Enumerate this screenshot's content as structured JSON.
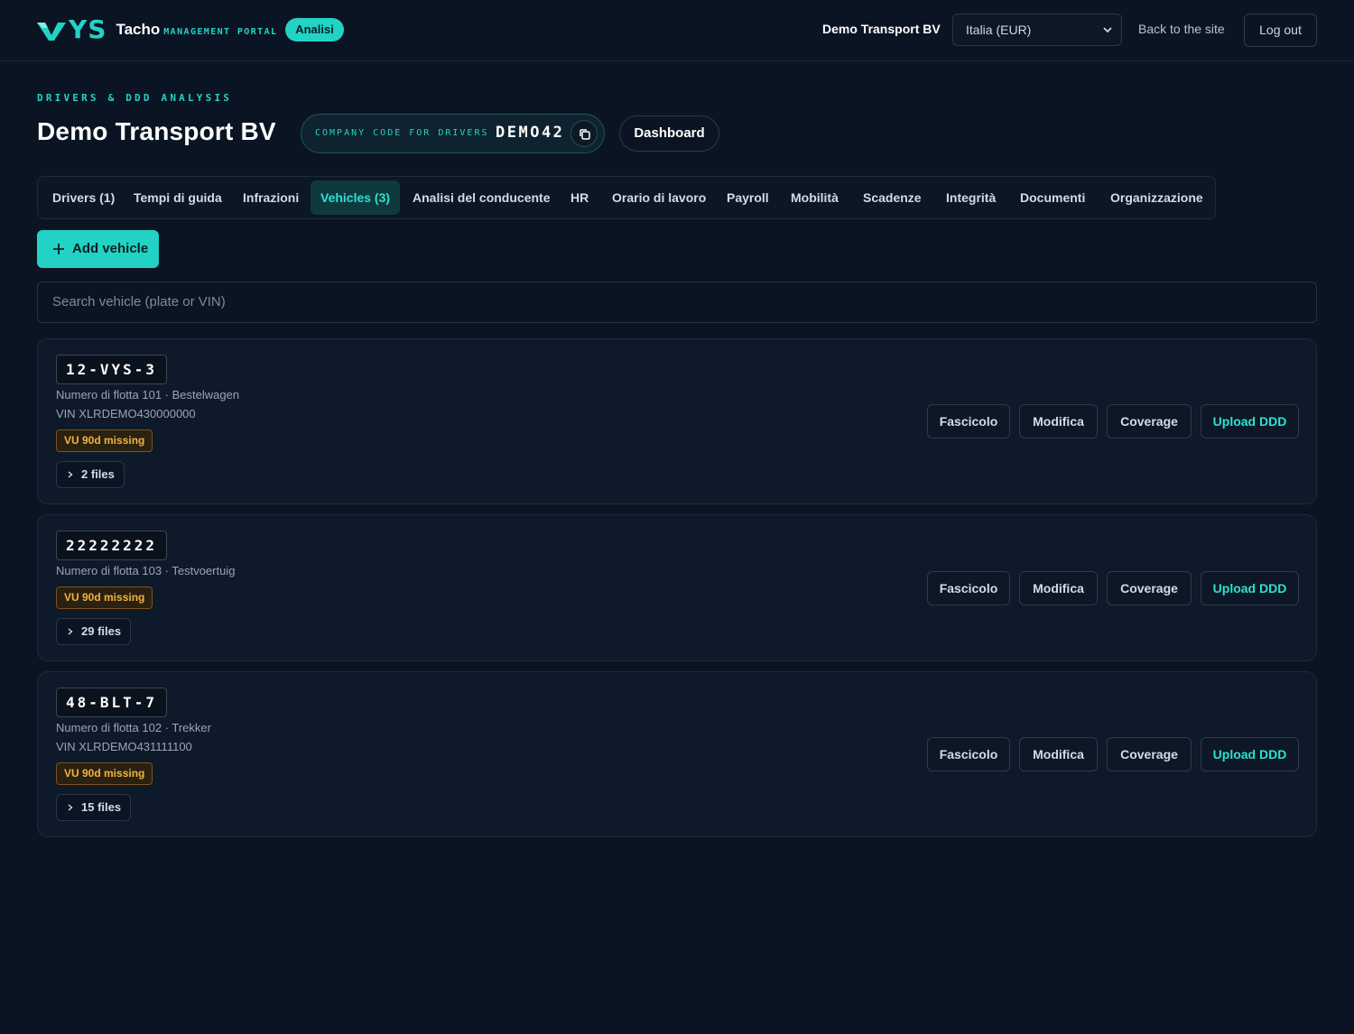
{
  "brand": {
    "logo_ys": "YS",
    "product": "Tacho",
    "portal": "MANAGEMENT PORTAL",
    "mode_badge": "Analisi"
  },
  "topbar": {
    "company": "Demo Transport BV",
    "region_select": "Italia (EUR)",
    "back_link": "Back to the site",
    "logout": "Log out"
  },
  "header": {
    "eyebrow": "DRIVERS & DDD ANALYSIS",
    "title": "Demo Transport BV",
    "code_label": "COMPANY CODE FOR DRIVERS",
    "code_value": "DEMO42",
    "dashboard": "Dashboard"
  },
  "tabs": [
    {
      "label": "Drivers (1)",
      "active": false
    },
    {
      "label": "Tempi di guida",
      "active": false
    },
    {
      "label": "Infrazioni",
      "active": false
    },
    {
      "label": "Vehicles (3)",
      "active": true
    },
    {
      "label": "Analisi del conducente",
      "active": false
    },
    {
      "label": "HR",
      "active": false
    },
    {
      "label": "Orario di lavoro",
      "active": false
    },
    {
      "label": "Payroll",
      "active": false
    },
    {
      "label": "Mobilità",
      "active": false
    },
    {
      "label": "Scadenze",
      "active": false
    },
    {
      "label": "Integrità",
      "active": false
    },
    {
      "label": "Documenti",
      "active": false
    },
    {
      "label": "Organizzazione",
      "active": false
    }
  ],
  "add_vehicle": "Add vehicle",
  "search": {
    "placeholder": "Search vehicle (plate or VIN)"
  },
  "actions": {
    "dossier": "Fascicolo",
    "edit": "Modifica",
    "coverage": "Coverage",
    "upload": "Upload DDD"
  },
  "vehicles": [
    {
      "plate": "12-VYS-3",
      "fleet": "Numero di flotta 101 · Bestelwagen",
      "vin": "VIN XLRDEMO430000000",
      "badge": "VU 90d missing",
      "files": "2 files"
    },
    {
      "plate": "22222222",
      "fleet": "Numero di flotta 103 · Testvoertuig",
      "vin": "",
      "badge": "VU 90d missing",
      "files": "29 files"
    },
    {
      "plate": "48-BLT-7",
      "fleet": "Numero di flotta 102 · Trekker",
      "vin": "VIN XLRDEMO431111100",
      "badge": "VU 90d missing",
      "files": "15 files"
    }
  ],
  "colors": {
    "background": "#0b1422",
    "accent": "#22d3c5",
    "warning": "#f3b341"
  }
}
